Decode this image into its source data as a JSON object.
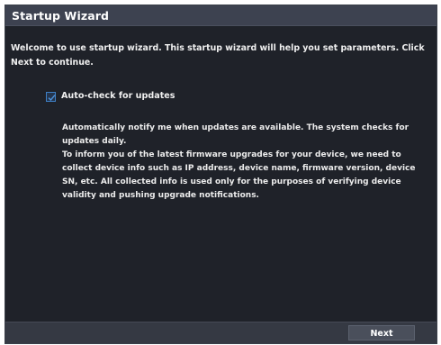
{
  "dialog": {
    "title": "Startup Wizard",
    "intro": "Welcome to use startup wizard. This startup wizard will help you set parameters. Click Next to continue.",
    "auto_check": {
      "label": "Auto-check for updates",
      "checked": true,
      "icon": "checkmark-icon"
    },
    "description": {
      "line1": "Automatically notify me when updates are available. The system checks for updates daily.",
      "line2": "To inform you of the latest firmware upgrades for your device, we need to collect device info such as IP address, device name, firmware version, device SN, etc. All collected info is used only for the purposes of verifying device validity and pushing upgrade notifications."
    },
    "footer": {
      "next_label": "Next"
    }
  },
  "colors": {
    "dialog_bg": "#1f2229",
    "titlebar_bg": "#3d4250",
    "footer_bg": "#353943",
    "checkbox_accent": "#3e7fc4"
  }
}
